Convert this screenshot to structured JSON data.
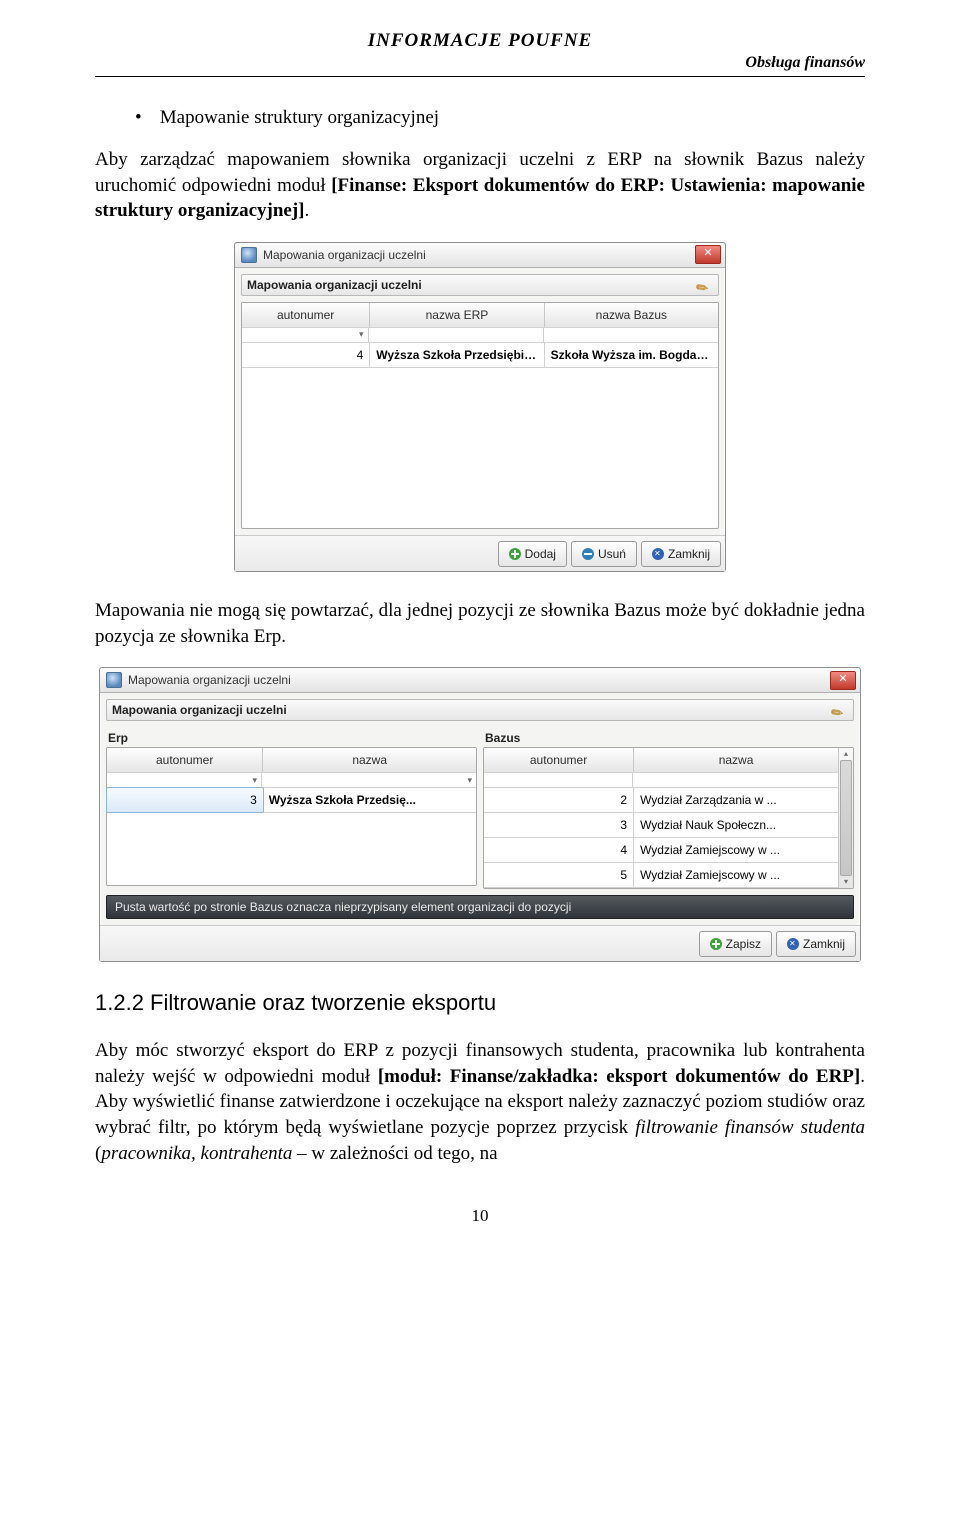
{
  "doc": {
    "header_title": "INFORMACJE  POUFNE",
    "header_sub": "Obsługa finansów",
    "page_number": "10"
  },
  "text": {
    "bullet1": "Mapowanie struktury organizacyjnej",
    "p1a": "Aby zarządzać mapowaniem słownika organizacji uczelni z ERP na słownik Bazus należy uruchomić odpowiedni moduł ",
    "p1b": "[Finanse: Eksport dokumentów do ERP: Ustawienia: mapowanie struktury organizacyjnej]",
    "p1c": ".",
    "p2": "Mapowania nie mogą się powtarzać, dla jednej pozycji ze słownika Bazus może być dokładnie jedna pozycja ze słownika Erp.",
    "h122": "1.2.2  Filtrowanie oraz tworzenie eksportu",
    "p3a": "Aby móc stworzyć eksport do ERP z pozycji finansowych studenta, pracownika lub kontrahenta należy wejść w odpowiedni moduł ",
    "p3b": "[moduł: Finanse/zakładka: eksport dokumentów do ERP]",
    "p3c": ". Aby wyświetlić finanse zatwierdzone i oczekujące na eksport należy zaznaczyć poziom studiów oraz wybrać filtr, po którym będą wyświetlane pozycje poprzez przycisk ",
    "p3d": "filtrowanie finansów studenta",
    "p3e": " (",
    "p3f": "pracownika, kontrahenta",
    "p3g": " – w zależności od tego, na"
  },
  "win1": {
    "title": "Mapowania organizacji uczelni",
    "subtitle": "Mapowania organizacji uczelni",
    "cols": [
      "autonumer",
      "nazwa ERP",
      "nazwa Bazus"
    ],
    "row": [
      "4",
      "Wyższa Szkoła Przedsiębior...",
      "Szkoła Wyższa im. Bogdana ..."
    ],
    "btn_add": "Dodaj",
    "btn_del": "Usuń",
    "btn_close": "Zamknij"
  },
  "win2": {
    "title": "Mapowania organizacji uczelni",
    "subtitle": "Mapowania organizacji uczelni",
    "pane_erp": "Erp",
    "pane_bazus": "Bazus",
    "erp_cols": [
      "autonumer",
      "nazwa"
    ],
    "bazus_cols": [
      "autonumer",
      "nazwa"
    ],
    "erp_row": [
      "3",
      "Wyższa Szkoła Przedsię..."
    ],
    "bazus_rows": [
      [
        "2",
        "Wydział Zarządzania w ..."
      ],
      [
        "3",
        "Wydział Nauk Społeczn..."
      ],
      [
        "4",
        "Wydział Zamiejscowy w ..."
      ],
      [
        "5",
        "Wydział Zamiejscowy w ..."
      ]
    ],
    "hint": "Pusta wartość po stronie Bazus oznacza nieprzypisany element organizacji do pozycji",
    "btn_save": "Zapisz",
    "btn_close": "Zamknij"
  }
}
